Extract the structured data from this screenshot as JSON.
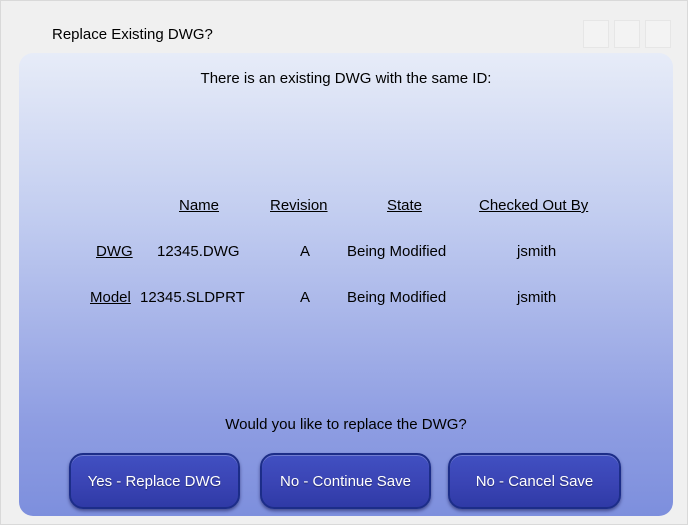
{
  "window": {
    "title": "Replace Existing DWG?"
  },
  "dialog": {
    "message": "There is an existing DWG with the same ID:",
    "columns": [
      "Name",
      "Revision",
      "State",
      "Checked Out By"
    ],
    "rows": [
      {
        "type": "DWG",
        "name": "12345.DWG",
        "revision": "A",
        "state": "Being Modified",
        "checked_out_by": "jsmith"
      },
      {
        "type": "Model",
        "name": "12345.SLDPRT",
        "revision": "A",
        "state": "Being Modified",
        "checked_out_by": "jsmith"
      }
    ],
    "question": "Would you like to replace the DWG?",
    "buttons": {
      "replace": "Yes - Replace DWG",
      "continue": "No - Continue Save",
      "cancel": "No - Cancel Save"
    }
  },
  "colors": {
    "button_fill": "#3a44b4",
    "button_border": "#1c2d88",
    "panel_top": "#e7ecf8",
    "panel_bottom": "#7d8fdd"
  }
}
